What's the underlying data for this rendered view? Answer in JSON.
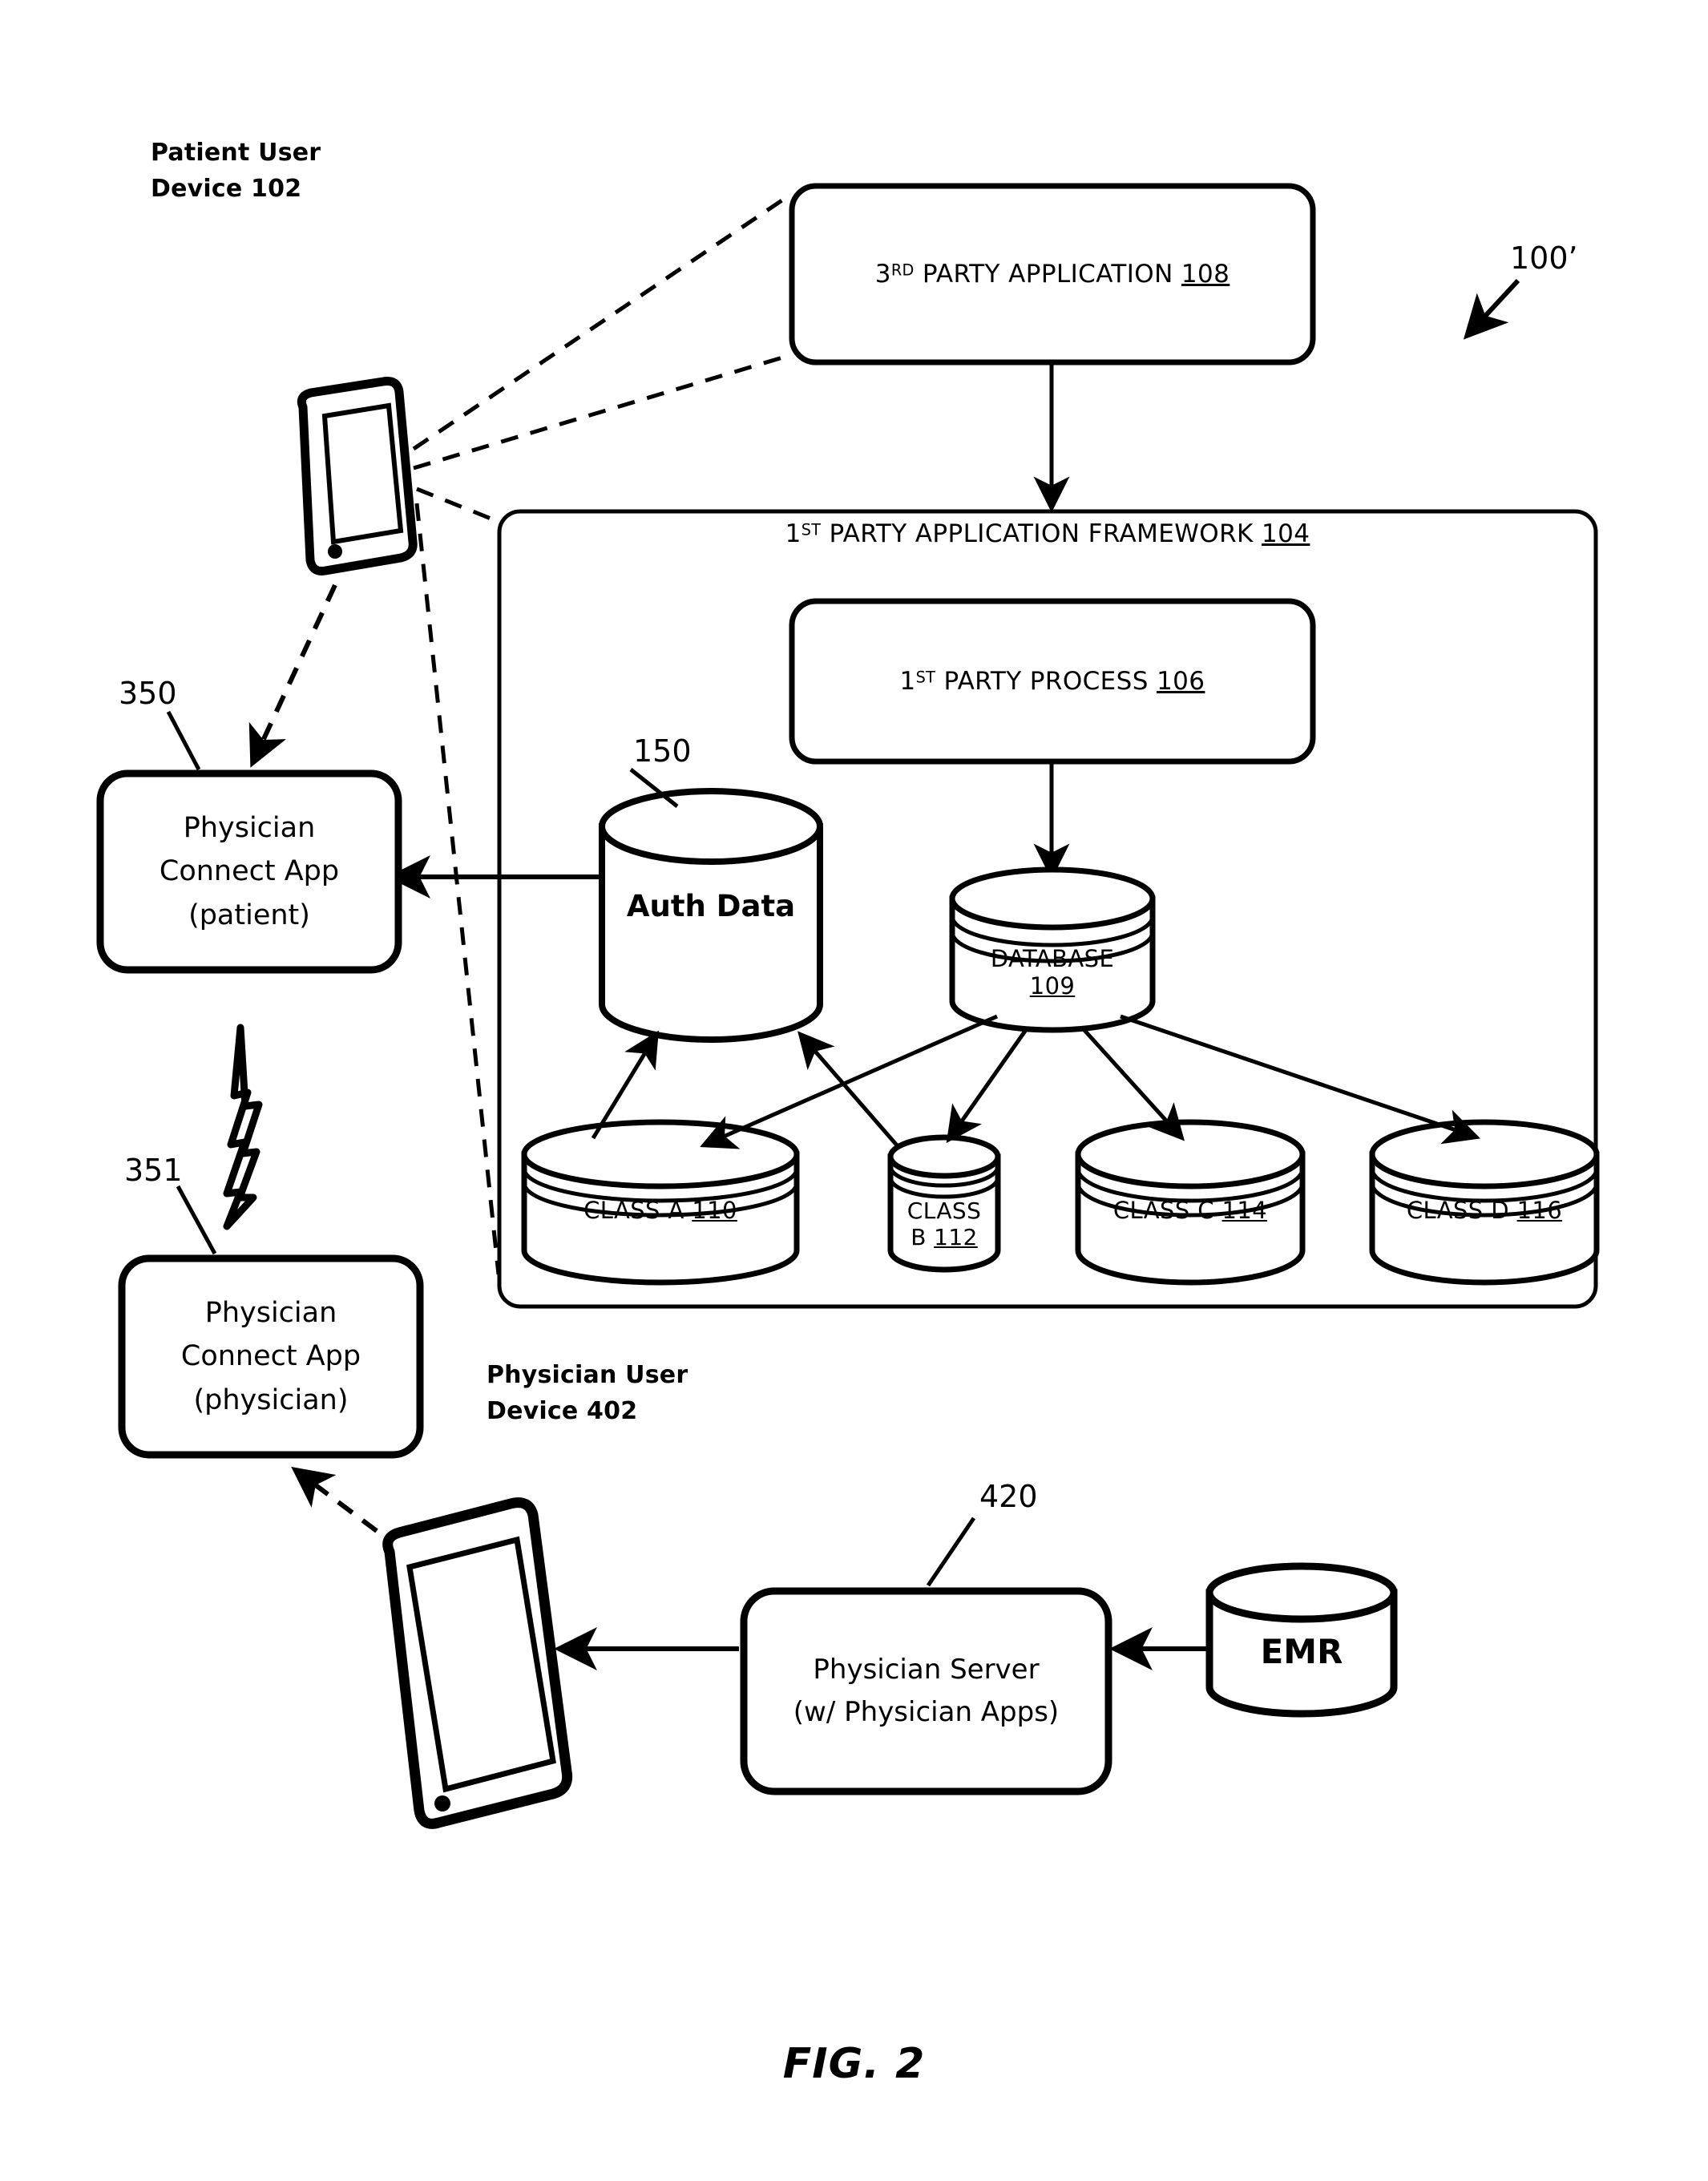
{
  "figure": {
    "caption": "FIG. 2",
    "system_ref": "100’"
  },
  "labels": {
    "patient_user_device_line1": "Patient User",
    "patient_user_device_line2": "Device 102",
    "physician_user_device_line1": "Physician User",
    "physician_user_device_line2": "Device 402",
    "ref_150": "150",
    "ref_350": "350",
    "ref_351": "351",
    "ref_420": "420"
  },
  "third_party_application": {
    "prefix": "3",
    "ordinal": "RD",
    "text": " PARTY APPLICATION ",
    "ref": "108"
  },
  "framework": {
    "prefix": "1",
    "ordinal": "ST",
    "text": " PARTY APPLICATION FRAMEWORK ",
    "ref": "104"
  },
  "first_party_process": {
    "prefix": "1",
    "ordinal": "ST",
    "text": " PARTY PROCESS ",
    "ref": "106"
  },
  "auth_data": {
    "label": "Auth Data"
  },
  "database": {
    "label": "DATABASE",
    "ref": "109"
  },
  "classes": [
    {
      "label": "CLASS A ",
      "ref": "110"
    },
    {
      "label_line1": "CLASS",
      "label_line2": "B ",
      "ref": "112"
    },
    {
      "label": "CLASS C ",
      "ref": "114"
    },
    {
      "label": "CLASS D ",
      "ref": "116"
    }
  ],
  "physician_connect_app_patient": {
    "line1": "Physician",
    "line2": "Connect App",
    "line3": "(patient)"
  },
  "physician_connect_app_physician": {
    "line1": "Physician",
    "line2": "Connect App",
    "line3": "(physician)"
  },
  "physician_server": {
    "line1": "Physician Server",
    "line2": "(w/ Physician Apps)"
  },
  "emr": {
    "label": "EMR"
  },
  "colors": {
    "ink": "#000000",
    "paper": "#ffffff"
  }
}
